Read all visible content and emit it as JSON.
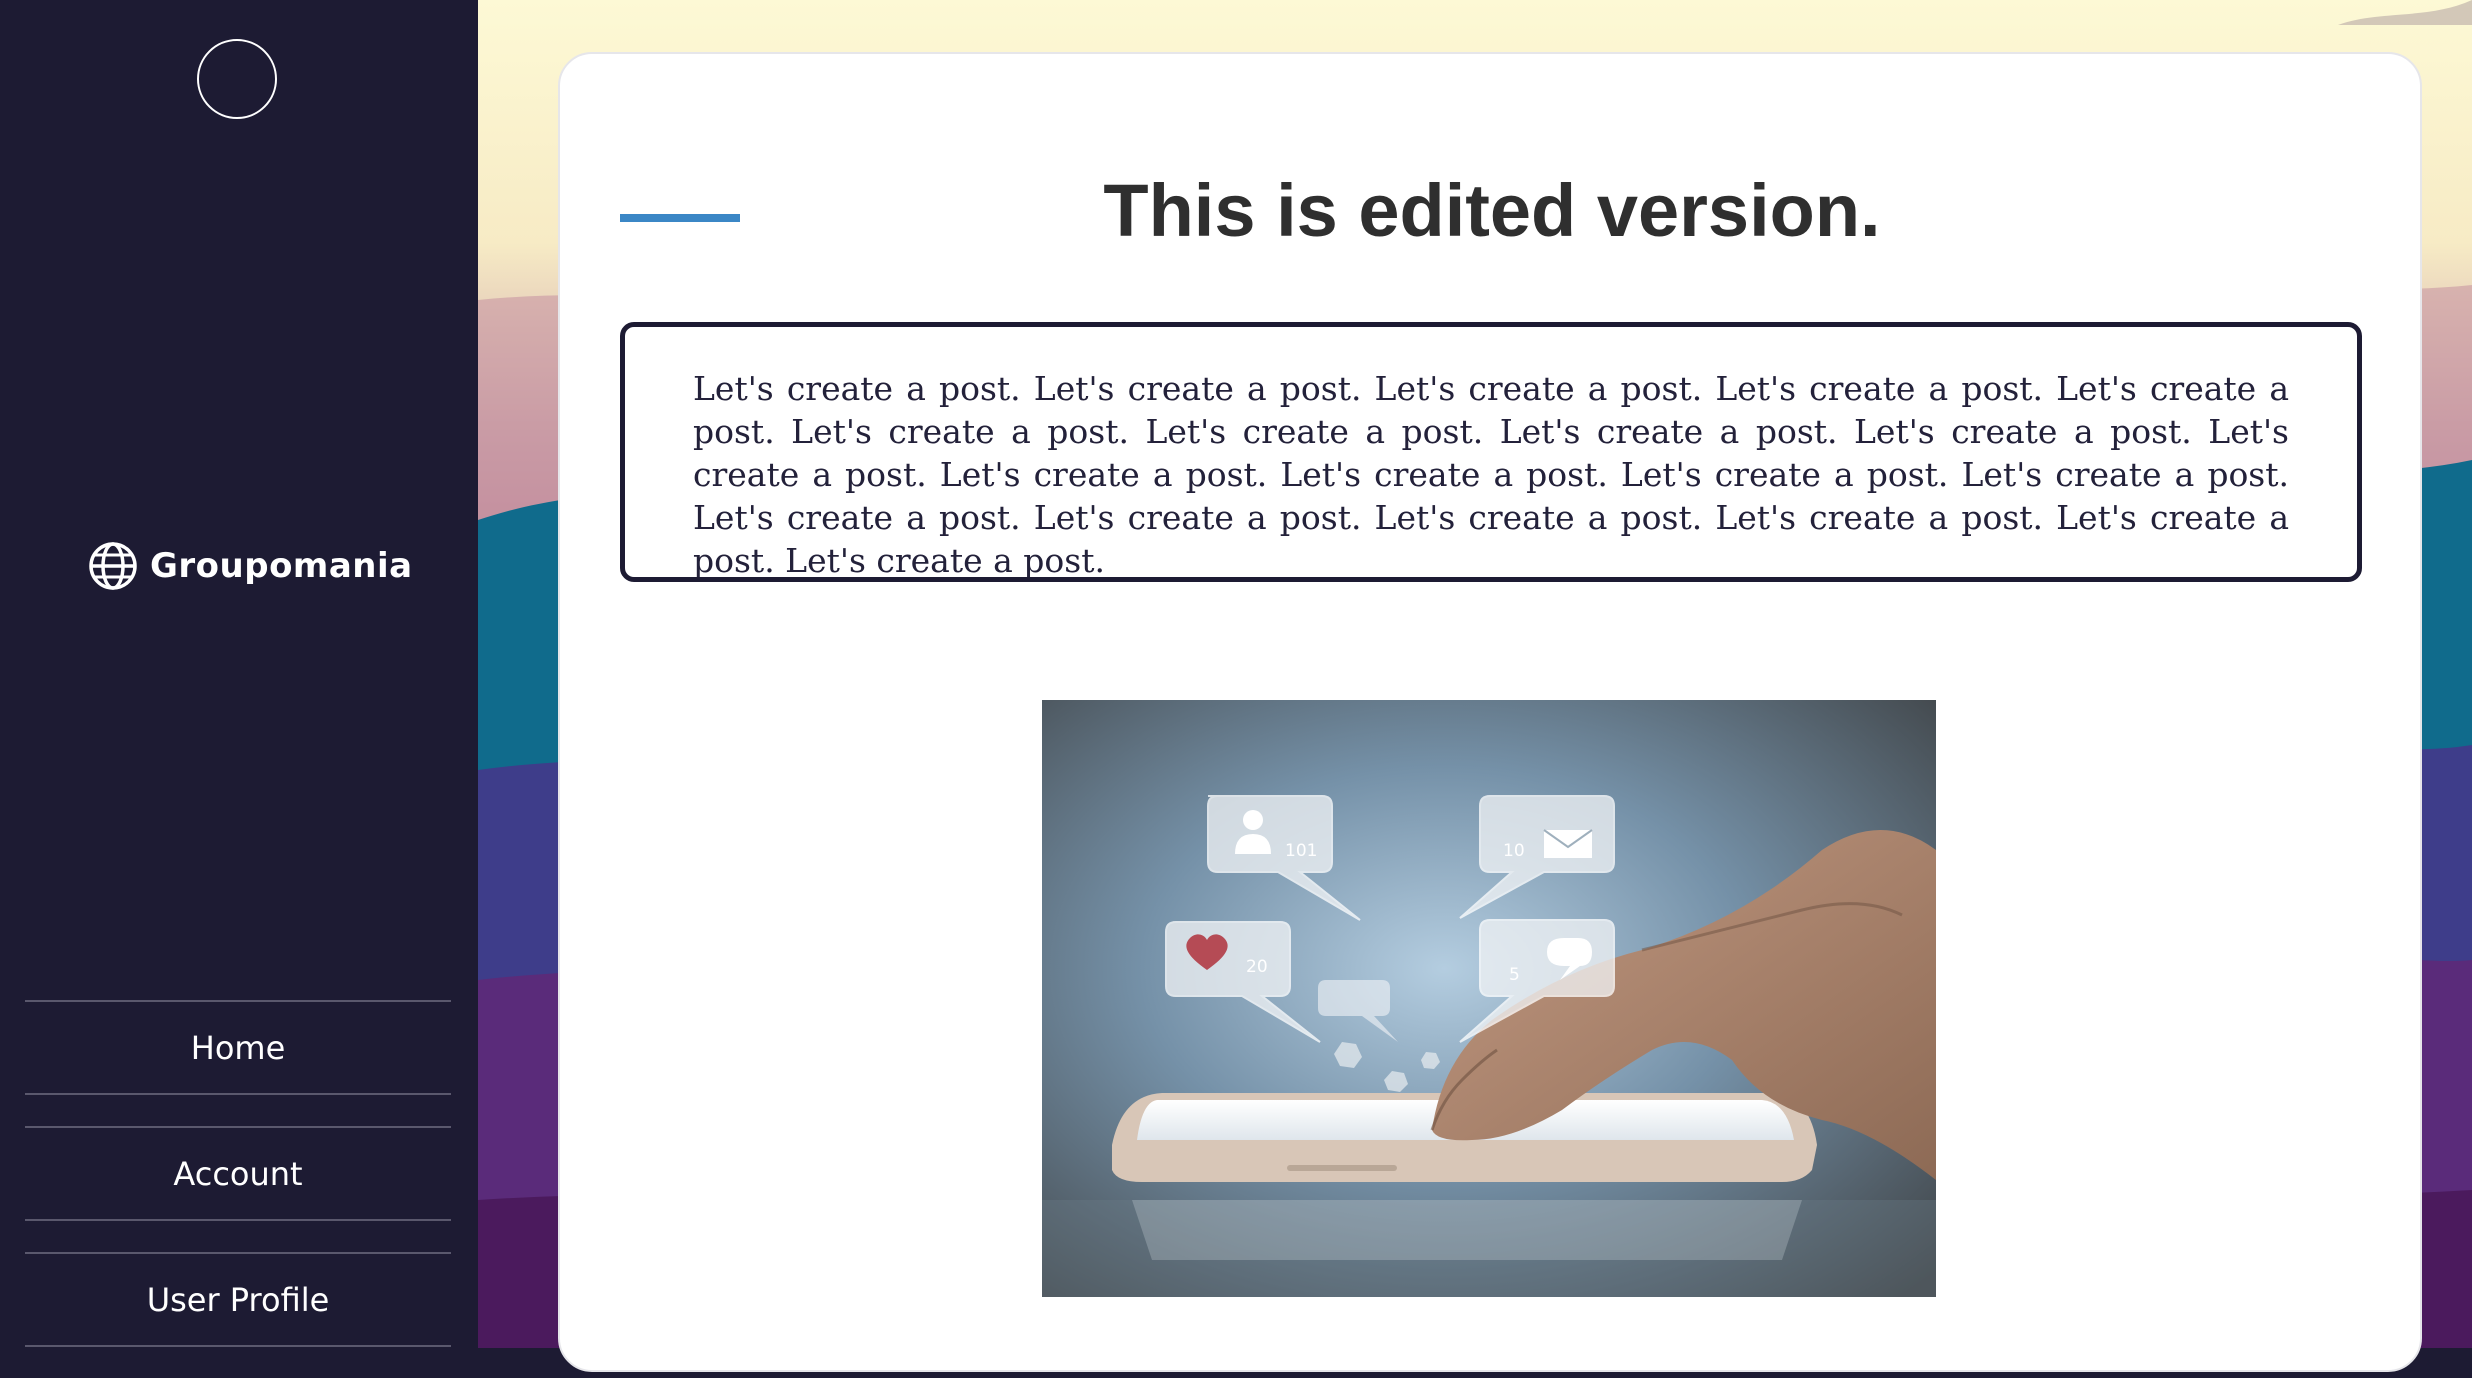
{
  "brand": {
    "name": "Groupomania"
  },
  "nav": {
    "items": [
      {
        "label": "Home"
      },
      {
        "label": "Account"
      },
      {
        "label": "User Profile"
      }
    ]
  },
  "post": {
    "title": "This is edited version.",
    "body": "Let's create a post. Let's create a post. Let's create a post. Let's create a post. Let's create a post. Let's create a post. Let's create a post. Let's create a post. Let's create a post. Let's create a post. Let's create a post. Let's create a post. Let's create a post. Let's create a post. Let's create a post. Let's create a post. Let's create a post. Let's create a post. Let's create a post. Let's create a post.",
    "image": {
      "bubbles": {
        "profile_count": "101",
        "mail_count": "10",
        "likes_count": "20",
        "comments_count": "5"
      }
    }
  },
  "colors": {
    "sidebar": "#1d1b33",
    "accent": "#3b87c6",
    "title": "#2f2f2f"
  },
  "icons": {
    "brand": "globe-icon",
    "profile": "user-icon",
    "mail": "envelope-icon",
    "like": "heart-icon",
    "comment": "speech-bubble-icon"
  }
}
